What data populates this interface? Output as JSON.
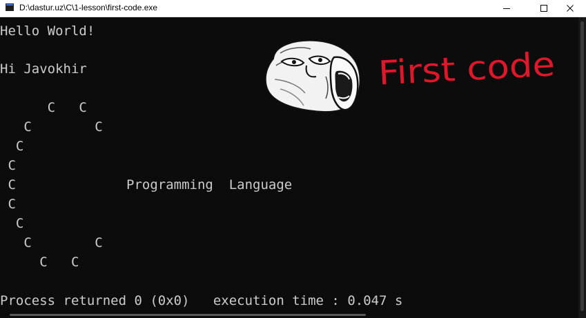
{
  "window": {
    "title": "D:\\dastur.uz\\C\\1-lesson\\first-code.exe",
    "controls": [
      "minimize",
      "maximize",
      "close"
    ]
  },
  "console": {
    "hello": "Hello World!",
    "hi": "Hi Javokhir",
    "art": [
      "      C   C",
      "   C        C",
      "  C",
      " C",
      " C              Programming  Language",
      " C",
      "  C",
      "   C        C",
      "     C   C"
    ],
    "process": "Process returned 0 (0x0)   execution time : 0.047 s"
  },
  "overlay": {
    "handwritten_text": "First code",
    "handwriting_color": "#e0162b",
    "image": "troll-face-icon"
  },
  "colors": {
    "console_bg": "#0c0c0c",
    "console_text": "#cccccc",
    "titlebar_bg": "#ffffff"
  }
}
